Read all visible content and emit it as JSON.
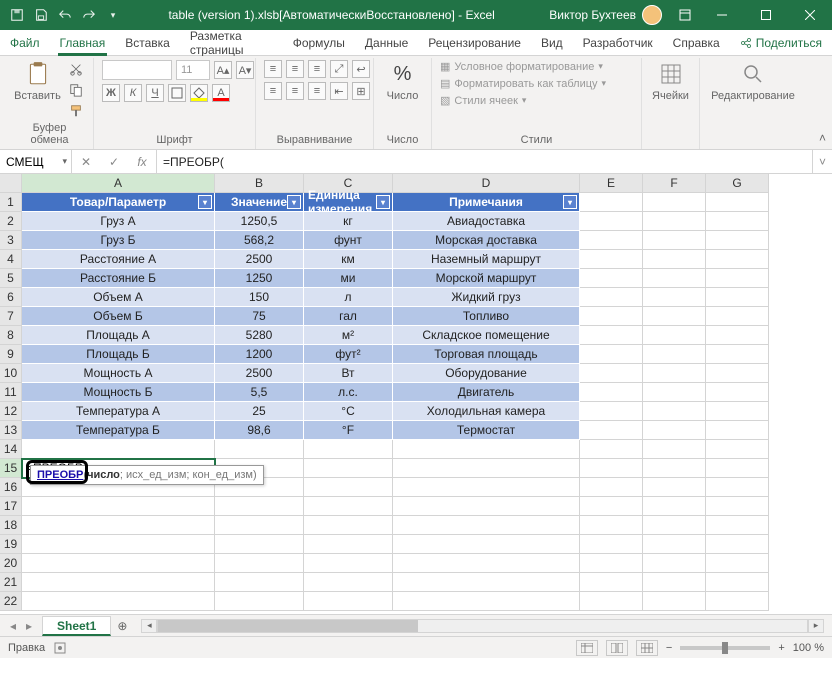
{
  "title": "table (version 1).xlsb[АвтоматическиВосстановлено] - Excel",
  "user": "Виктор Бухтеев",
  "tabs": {
    "file": "Файл",
    "items": [
      "Главная",
      "Вставка",
      "Разметка страницы",
      "Формулы",
      "Данные",
      "Рецензирование",
      "Вид",
      "Разработчик",
      "Справка"
    ],
    "share": "Поделиться"
  },
  "ribbon": {
    "clipboard_label": "Буфер обмена",
    "paste_label": "Вставить",
    "font_label": "Шрифт",
    "alignment_label": "Выравнивание",
    "number_group_label": "Число",
    "number_btn": "Число",
    "styles_label": "Стили",
    "cond_fmt": "Условное форматирование",
    "table_fmt": "Форматировать как таблицу",
    "cell_styles": "Стили ячеек",
    "cells_label": "Ячейки",
    "editing_label": "Редактирование",
    "bold": "Ж",
    "italic": "К",
    "underline": "Ч",
    "font_size": "11"
  },
  "namebox": "СМЕЩ",
  "formula": "=ПРЕОБР(",
  "columns": [
    "A",
    "B",
    "C",
    "D",
    "E",
    "F",
    "G"
  ],
  "headers": [
    "Товар/Параметр",
    "Значение",
    "Единица измерения",
    "Примечания"
  ],
  "rows": [
    [
      "Груз А",
      "1250,5",
      "кг",
      "Авиадоставка"
    ],
    [
      "Груз Б",
      "568,2",
      "фунт",
      "Морская доставка"
    ],
    [
      "Расстояние А",
      "2500",
      "км",
      "Наземный маршрут"
    ],
    [
      "Расстояние Б",
      "1250",
      "ми",
      "Морской маршрут"
    ],
    [
      "Объем А",
      "150",
      "л",
      "Жидкий груз"
    ],
    [
      "Объем Б",
      "75",
      "гал",
      "Топливо"
    ],
    [
      "Площадь А",
      "5280",
      "м²",
      "Складское помещение"
    ],
    [
      "Площадь Б",
      "1200",
      "фут²",
      "Торговая площадь"
    ],
    [
      "Мощность А",
      "2500",
      "Вт",
      "Оборудование"
    ],
    [
      "Мощность Б",
      "5,5",
      "л.с.",
      "Двигатель"
    ],
    [
      "Температура А",
      "25",
      "°C",
      "Холодильная камера"
    ],
    [
      "Температура Б",
      "98,6",
      "°F",
      "Термостат"
    ]
  ],
  "active_cell_text": "=ПРЕОБР(",
  "tooltip": {
    "fn": "ПРЕОБР",
    "args": "(число; исх_ед_изм; кон_ед_изм)"
  },
  "sheet": "Sheet1",
  "status": "Правка",
  "zoom": "100 %"
}
